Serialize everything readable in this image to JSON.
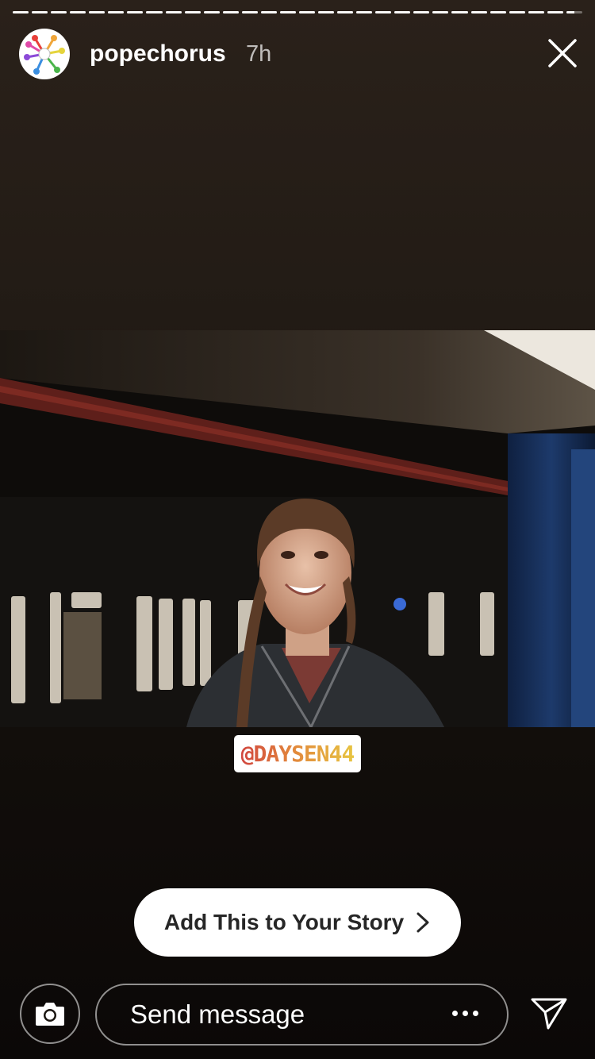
{
  "header": {
    "username": "popechorus",
    "time_ago": "7h",
    "avatar_icon": "colorful-music-notes-logo",
    "close_icon": "close-icon"
  },
  "progress": {
    "segments_total": 30,
    "segments_viewed": 29,
    "current_segment_progress": 0.5
  },
  "sticker": {
    "mention": "@DAYSEN44"
  },
  "cta": {
    "add_to_story_label": "Add This to Your Story",
    "chevron_icon": "chevron-right-icon"
  },
  "footer": {
    "camera_icon": "camera-icon",
    "message_placeholder": "Send message",
    "more_icon": "more-dots-icon",
    "send_icon": "direct-send-icon"
  },
  "colors": {
    "background_top": "#2a211a",
    "background_bottom": "#0b0807",
    "button_bg": "#ffffff",
    "button_text": "#262626"
  }
}
